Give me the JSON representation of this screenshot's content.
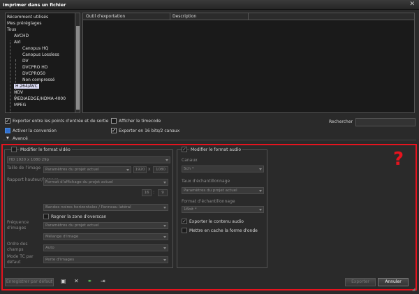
{
  "window": {
    "title": "Imprimer dans un fichier",
    "close_icon": "close-icon"
  },
  "tree": {
    "items": [
      "Récemment utilisés",
      "Mes préréglages",
      "Tous",
      "AVCHD",
      "AVI",
      "Canopus HQ",
      "Canopus Lossless",
      "DV",
      "DVCPRO HD",
      "DVCPRO50",
      "Non compressé",
      "H.264/AVC",
      "HDV",
      "MEDIAEDGE/HDMA-4000",
      "MPEG"
    ],
    "selected_index": 11
  },
  "table": {
    "columns": [
      "Outil d'exportation",
      "Description"
    ]
  },
  "options": {
    "export_inout": "Exporter entre les points d'entrée et de sortie",
    "show_timecode": "Afficher le timecode",
    "enable_conversion": "Activer la conversion",
    "export_16bit": "Exporter en 16 bits/2 canaux",
    "search_label": "Rechercher",
    "advanced": "Avancé"
  },
  "video": {
    "modify_label": "Modifier le format vidéo",
    "format_value": "HD 1920 x 1080 29p",
    "image_size_label": "Taille de l'image",
    "image_size_value": "Paramètres du projet actuel",
    "width": "1920",
    "times": "x",
    "height": "1080",
    "aspect_label": "Rapport hauteur/largeur",
    "aspect_value": "Format d'affichage du projet actuel",
    "ratio_a": "16",
    "ratio_sep": ":",
    "ratio_b": "9",
    "bars_value": "Bandes noires horizontales / Panneau latéral",
    "crop_label": "Rogner la zone d'overscan",
    "frame_rate_label": "Fréquence d'images",
    "frame_rate_value": "Paramètres du projet actuel",
    "mix_value": "Mélange d'image",
    "field_order_label": "Ordre des champs",
    "field_order_value": "Auto",
    "tc_mode_label": "Mode TC par défaut",
    "tc_mode_value": "Perte d'images"
  },
  "audio": {
    "modify_label": "Modifier le format audio",
    "channels_label": "Canaux",
    "channels_value": "5ch *",
    "sample_rate_label": "Taux d'échantillonnage",
    "sample_rate_value": "Paramètres du projet actuel",
    "sample_format_label": "Format d'échantillonnage",
    "sample_format_value": "16bit *",
    "export_content": "Exporter le contenu audio",
    "cache_waveform": "Mettre en cache la forme d'onde"
  },
  "footer": {
    "save_default": "Enregistrer par défaut",
    "export": "Exporter",
    "cancel": "Annuler"
  },
  "annotation": {
    "qmark": "?"
  },
  "colors": {
    "annotation_red": "#e6131e",
    "checkbox_blue": "#2f6fd0"
  }
}
